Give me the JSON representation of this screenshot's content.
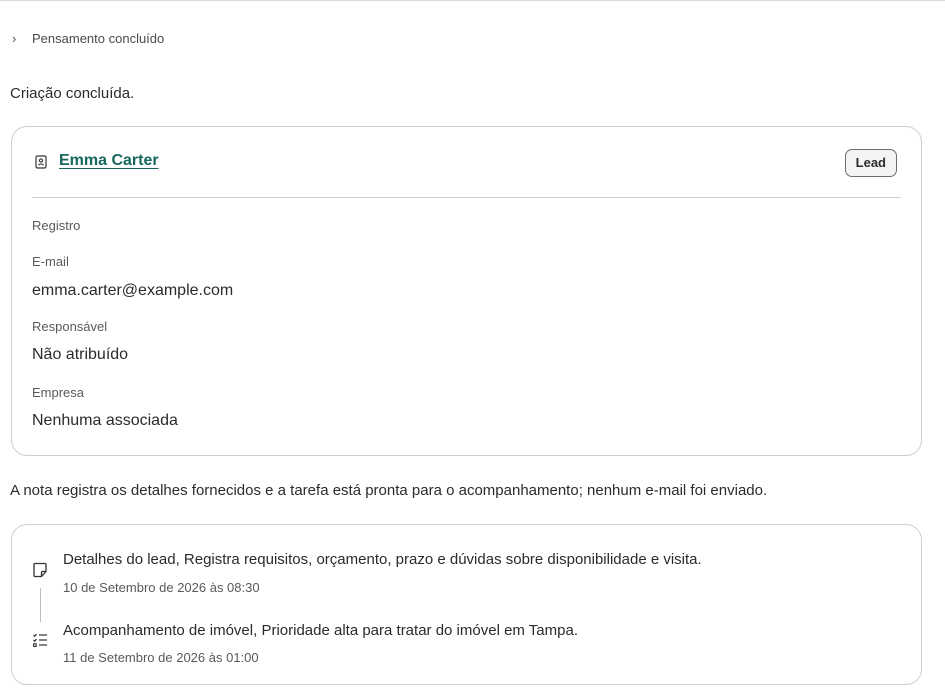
{
  "thinking": {
    "label": "Pensamento concluído"
  },
  "status": {
    "text": "Criação concluída."
  },
  "record_card": {
    "name": "Emma Carter",
    "badge": "Lead",
    "section_title": "Registro",
    "fields": [
      {
        "label": "E-mail",
        "value": "emma.carter@example.com"
      },
      {
        "label": "Responsável",
        "value": "Não atribuído"
      },
      {
        "label": "Empresa",
        "value": "Nenhuma associada"
      }
    ]
  },
  "summary": {
    "text": "A nota registra os detalhes fornecidos e a tarefa está pronta para o acompanhamento; nenhum e-mail foi enviado."
  },
  "timeline": {
    "items": [
      {
        "icon": "note-icon",
        "title": "Detalhes do lead, Registra requisitos, orçamento, prazo e dúvidas sobre disponibilidade e visita.",
        "date": "10 de Setembro de 2026 às 08:30"
      },
      {
        "icon": "task-list-icon",
        "title": "Acompanhamento de imóvel, Prioridade alta para tratar do imóvel em Tampa.",
        "date": "11 de Setembro de 2026 às 01:00"
      }
    ]
  },
  "colors": {
    "link": "#17675f",
    "border": "#cfcfcf",
    "text": "#2b2b2b",
    "muted": "#5a5a5a"
  }
}
